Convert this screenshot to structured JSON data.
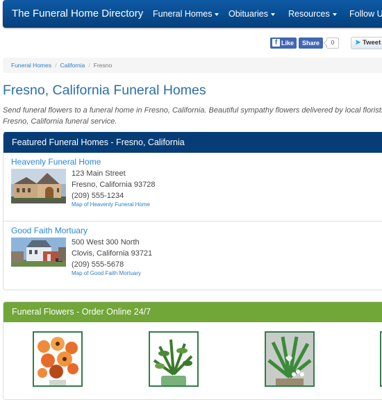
{
  "navbar": {
    "brand": "The Funeral Home Directory",
    "items": [
      {
        "label": "Funeral Homes",
        "has_dropdown": true
      },
      {
        "label": "Obituaries",
        "has_dropdown": true
      },
      {
        "label": "Resources",
        "has_dropdown": true
      },
      {
        "label": "Follow Us",
        "has_dropdown": false
      }
    ]
  },
  "social": {
    "facebook_like": "Like",
    "facebook_share": "Share",
    "share_count": "0",
    "tweet": "Tweet"
  },
  "breadcrumb": [
    {
      "label": "Funeral Homes",
      "link": true
    },
    {
      "label": "California",
      "link": true
    },
    {
      "label": "Fresno",
      "link": false
    }
  ],
  "page": {
    "title": "Fresno, California Funeral Homes",
    "intro": "Send funeral flowers to a funeral home in Fresno, California. Beautiful sympathy flowers delivered by local florists to any Fresno, California funeral service."
  },
  "featured": {
    "heading": "Featured Funeral Homes - Fresno, California",
    "listings": [
      {
        "name": "Heavenly Funeral Home",
        "street": "123 Main Street",
        "city_state_zip": "Fresno, California 93728",
        "phone": "(209) 555-1234",
        "map_link": "Map of Heavenly Funeral Home",
        "image": "stone-building-photo"
      },
      {
        "name": "Good Faith Mortuary",
        "street": "500 West 300 North",
        "city_state_zip": "Clovis, California 93721",
        "phone": "(209) 555-5678",
        "map_link": "Map of Good Faith Mortuary",
        "image": "victorian-house-photo"
      }
    ]
  },
  "flowers": {
    "heading": "Funeral Flowers - Order Online 24/7",
    "items": [
      {
        "image": "orange-roses-gerbera-bouquet"
      },
      {
        "image": "green-plant-in-ceramic-planter"
      },
      {
        "image": "fern-basket-white-flowers"
      },
      {
        "image": "flower-arrangement-partial"
      }
    ]
  },
  "colors": {
    "navbar": "#084c8f",
    "featured_heading": "#063d77",
    "flowers_heading": "#71a638",
    "link": "#2a86d4",
    "title": "#2a6fa8"
  }
}
